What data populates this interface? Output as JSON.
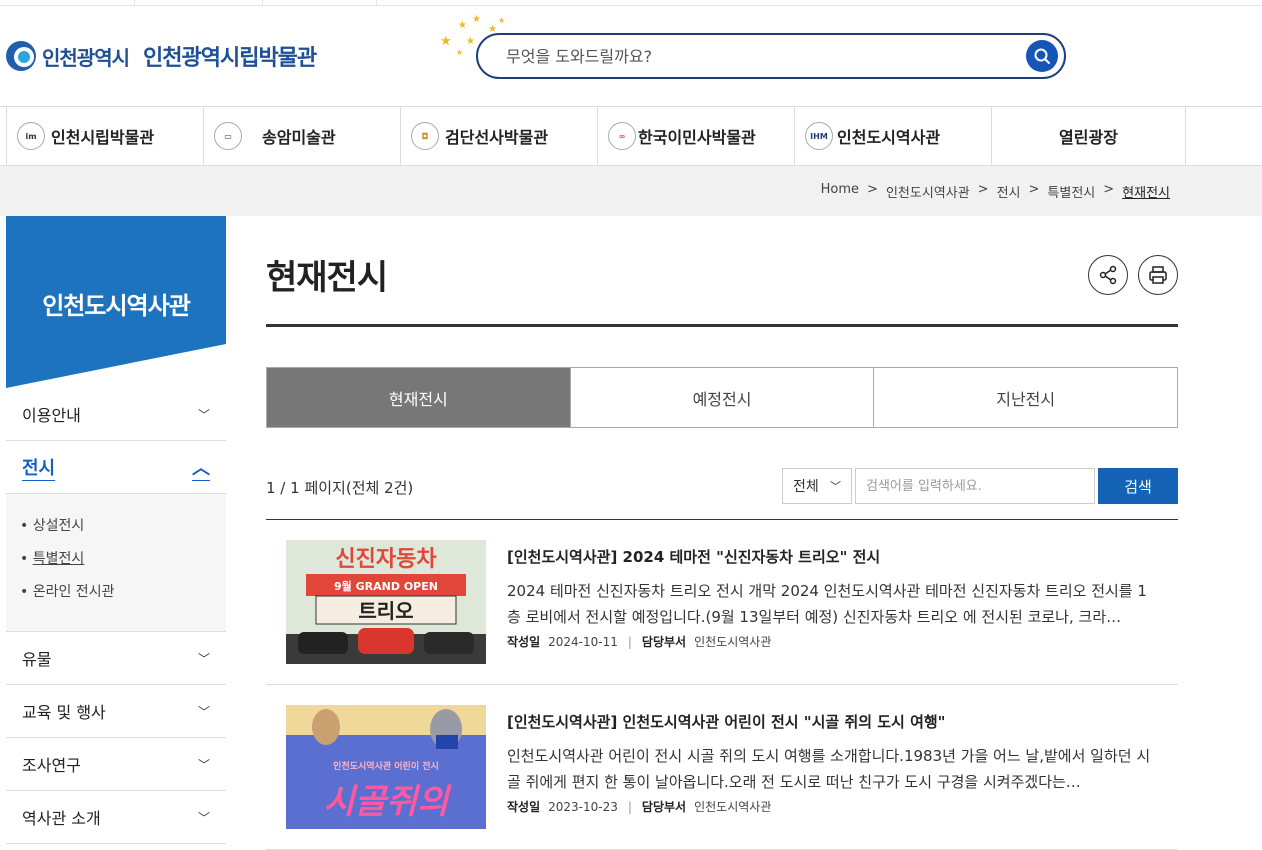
{
  "header": {
    "city_logo": "인천광역시",
    "museum_name": "인천광역시립박물관",
    "search_placeholder": "무엇을 도와드릴까요?"
  },
  "gnb": [
    {
      "label": "인천시립박물관",
      "icon": "incheon-museum-icon",
      "icon_text": "im"
    },
    {
      "label": "송암미술관",
      "icon": "art-museum-icon",
      "icon_text": ""
    },
    {
      "label": "검단선사박물관",
      "icon": "prehistory-museum-icon",
      "icon_text": ""
    },
    {
      "label": "한국이민사박물관",
      "icon": "immigration-museum-icon",
      "icon_text": ""
    },
    {
      "label": "인천도시역사관",
      "icon": "city-history-icon",
      "icon_text": "IHM"
    },
    {
      "label": "열린광장",
      "icon": "",
      "icon_text": ""
    }
  ],
  "breadcrumb": {
    "home": "Home",
    "sep": ">",
    "l1": "인천도시역사관",
    "l2": "전시",
    "l3": "특별전시",
    "current": "현재전시"
  },
  "lnb": {
    "title": "인천도시역사관",
    "m0": "이용안내",
    "m1": "전시",
    "sub": [
      "상설전시",
      "특별전시",
      "온라인 전시관"
    ],
    "m2": "유물",
    "m3": "교육 및 행사",
    "m4": "조사연구",
    "m5": "역사관 소개"
  },
  "page": {
    "title": "현재전시"
  },
  "tabs": [
    "현재전시",
    "예정전시",
    "지난전시"
  ],
  "search_bar": {
    "count": "1 / 1 페이지(전체 2건)",
    "select": "전체",
    "placeholder": "검색어를 입력하세요.",
    "button": "검색"
  },
  "items": [
    {
      "title": "[인천도시역사관] 2024 테마전 \"신진자동차 트리오\" 전시",
      "desc": "2024 테마전 신진자동차 트리오 전시 개막  2024 인천도시역사관 테마전 신진자동차 트리오 전시를 1층 로비에서 전시할 예정입니다.(9월 13일부터 예정)  신진자동차 트리오 에 전시된 코로나, 크라…",
      "date_label": "작성일",
      "date": "2024-10-11",
      "dept_label": "담당부서",
      "dept": "인천도시역사관",
      "thumb": {
        "t1": "신진자동차",
        "t2": "9월 GRAND OPEN",
        "t3": "트리오"
      }
    },
    {
      "title": "[인천도시역사관] 인천도시역사관 어린이 전시 \"시골 쥐의 도시 여행\"",
      "desc": "인천도시역사관 어린이 전시 시골 쥐의 도시 여행를 소개합니다.1983년 가을 어느 날,밭에서 일하던 시골 쥐에게 편지 한 통이 날아옵니다.오래 전 도시로 떠난 친구가 도시 구경을 시켜주겠다는…",
      "date_label": "작성일",
      "date": "2023-10-23",
      "dept_label": "담당부서",
      "dept": "인천도시역사관",
      "thumb": {
        "t1": "인천도시역사관 어린이 전시",
        "t2": "시골쥐의"
      }
    }
  ],
  "colors": {
    "lnb_blue": "#1e73be",
    "nav_dark": "#1d3f7e",
    "tab_active": "#777777",
    "search_btn": "#1463b6"
  }
}
